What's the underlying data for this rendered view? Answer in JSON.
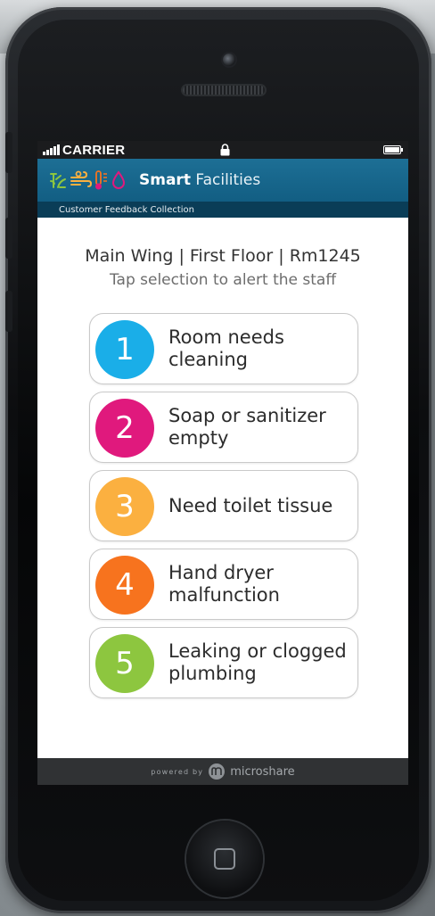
{
  "status_bar": {
    "carrier": "CARRIER",
    "icons": [
      "signal-icon",
      "lock-icon",
      "battery-icon"
    ]
  },
  "header": {
    "title_bold": "Smart",
    "title_light": "Facilities",
    "subtitle": "Customer Feedback Collection",
    "logo_icons": [
      "plant-icon",
      "wind-icon",
      "thermometer-icon",
      "water-drop-icon"
    ],
    "colors": {
      "bar": "#176891",
      "subbar": "#0a3d57"
    }
  },
  "location": {
    "wing": "Main Wing",
    "floor": "First Floor",
    "room": "Rm1245",
    "separator": "|"
  },
  "instruction": "Tap selection to alert the staff",
  "options": [
    {
      "number": "1",
      "label": "Room needs\ncleaning",
      "color": "#1aaee8"
    },
    {
      "number": "2",
      "label": "Soap or sanitizer\nempty",
      "color": "#e0197d"
    },
    {
      "number": "3",
      "label": "Need toilet tissue",
      "color": "#fbb040"
    },
    {
      "number": "4",
      "label": "Hand dryer\nmalfunction",
      "color": "#f7731e"
    },
    {
      "number": "5",
      "label": "Leaking or clogged\nplumbing",
      "color": "#8dc63f"
    }
  ],
  "footer": {
    "powered_by": "powered by",
    "brand": "microshare",
    "logo_icon": "microshare-logo-icon"
  }
}
